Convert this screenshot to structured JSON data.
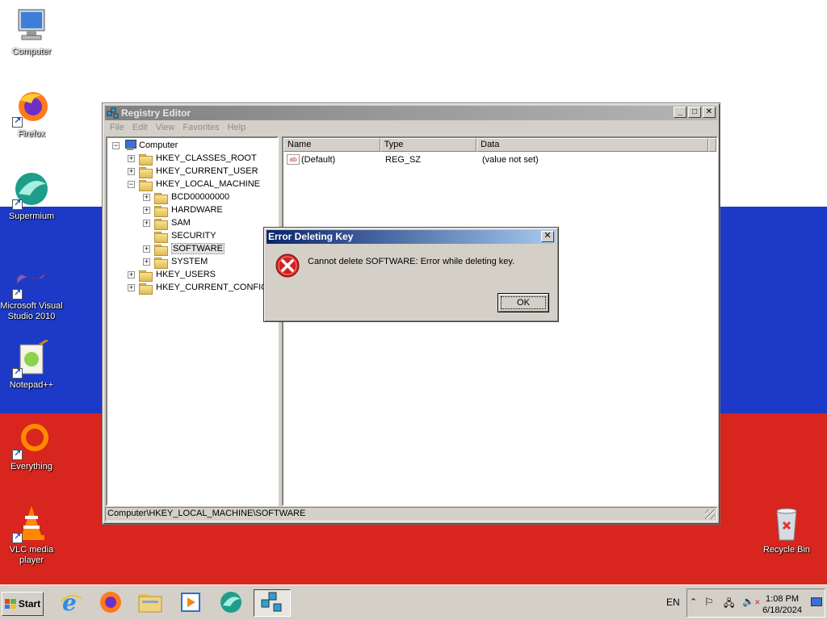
{
  "desktop": {
    "icons": [
      {
        "label": "Computer"
      },
      {
        "label": "Firefox"
      },
      {
        "label": "Supermium"
      },
      {
        "label": "Microsoft Visual Studio 2010"
      },
      {
        "label": "Notepad++"
      },
      {
        "label": "Everything"
      },
      {
        "label": "VLC media player"
      },
      {
        "label": "Recycle Bin"
      }
    ]
  },
  "registry_editor": {
    "title": "Registry Editor",
    "menu": [
      "File",
      "Edit",
      "View",
      "Favorites",
      "Help"
    ],
    "tree": {
      "root": "Computer",
      "hkcr": "HKEY_CLASSES_ROOT",
      "hkcu": "HKEY_CURRENT_USER",
      "hklm": "HKEY_LOCAL_MACHINE",
      "hklm_children": [
        "BCD00000000",
        "HARDWARE",
        "SAM",
        "SECURITY",
        "SOFTWARE",
        "SYSTEM"
      ],
      "hku": "HKEY_USERS",
      "hkcc": "HKEY_CURRENT_CONFIG"
    },
    "columns": {
      "name": "Name",
      "type": "Type",
      "data": "Data"
    },
    "rows": [
      {
        "name": "(Default)",
        "type": "REG_SZ",
        "data": "(value not set)"
      }
    ],
    "status": "Computer\\HKEY_LOCAL_MACHINE\\SOFTWARE"
  },
  "error_dialog": {
    "title": "Error Deleting Key",
    "message": "Cannot delete SOFTWARE:  Error while deleting key.",
    "ok_label": "OK"
  },
  "taskbar": {
    "start_label": "Start",
    "language": "EN",
    "time": "1:08 PM",
    "date": "6/18/2024"
  }
}
